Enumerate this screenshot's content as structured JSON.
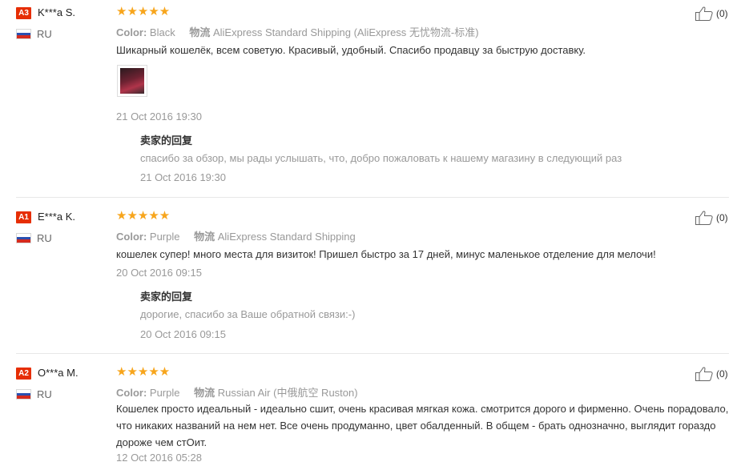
{
  "reviews": [
    {
      "badge": "A3",
      "name": "K***a S.",
      "country": "RU",
      "stars": "★★★★★",
      "color_label": "Color:",
      "color_value": "Black",
      "shipping_label": "物流",
      "shipping_value": "AliExpress Standard Shipping (AliExpress 无忧物流-标准)",
      "text": "Шикарный кошелёк, всем советую. Красивый, удобный. Спасибо продавцу за быструю доставку.",
      "date": "21 Oct 2016 19:30",
      "reply_title": "卖家的回复",
      "reply_text": "спасибо за обзор, мы рады услышать, что, добро пожаловать к нашему магазину в следующий раз",
      "reply_date": "21 Oct 2016 19:30",
      "likes": "(0)"
    },
    {
      "badge": "A1",
      "name": "E***a K.",
      "country": "RU",
      "stars": "★★★★★",
      "color_label": "Color:",
      "color_value": "Purple",
      "shipping_label": "物流",
      "shipping_value": "AliExpress Standard Shipping",
      "text": "кошелек супер! много места для визиток! Пришел быстро за 17 дней, минус маленькое отделение для мелочи!",
      "date": "20 Oct 2016 09:15",
      "reply_title": "卖家的回复",
      "reply_text": "дорогие, спасибо за Ваше обратной связи:-)",
      "reply_date": "20 Oct 2016 09:15",
      "likes": "(0)"
    },
    {
      "badge": "A2",
      "name": "O***a M.",
      "country": "RU",
      "stars": "★★★★★",
      "color_label": "Color:",
      "color_value": "Purple",
      "shipping_label": "物流",
      "shipping_value": "Russian Air (中俄航空 Ruston)",
      "text": "Кошелек просто идеальный - идеально сшит, очень красивая мягкая кожа. смотрится дорого и фирменно. Очень порадовало, что никаких названий на нем нет. Все очень продуманно, цвет обалденный. В общем - брать однозначно, выглядит гораздо дороже чем стОит.",
      "date": "12 Oct 2016 05:28",
      "likes": "(0)"
    }
  ],
  "colors": {
    "badge": "#e62e04",
    "stars": "#f7a51c",
    "muted": "#999999"
  },
  "icons": {
    "like": "thumbs-up-icon",
    "flag": "russia-flag-icon"
  }
}
